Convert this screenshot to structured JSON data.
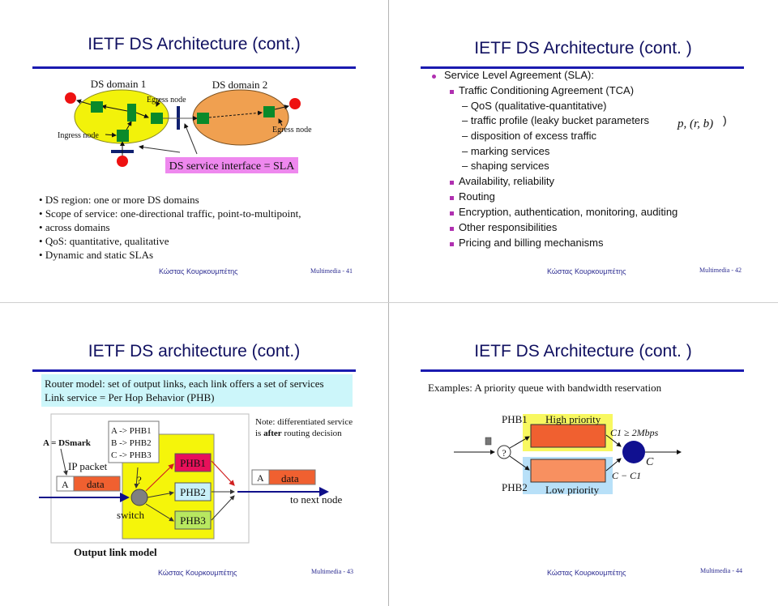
{
  "slides": [
    {
      "title": "IETF DS Architecture (cont.)",
      "diagram": {
        "domain1_label": "DS domain 1",
        "domain2_label": "DS domain 2",
        "egress1_label": "Egress node",
        "egress2_label": "Egress node",
        "ingress_label": "Ingress node",
        "sla_label": "DS service interface = SLA",
        "colors": {
          "domain1": "#f2f20a",
          "domain2": "#f0a050",
          "node": "#0a8a2a",
          "endpoint": "#ee1111",
          "interface": "#102070",
          "sla_box": "#ee88ee"
        }
      },
      "bullets": [
        "DS region: one or more DS domains",
        "Scope of service: one-directional traffic, point-to-multipoint,",
        "across domains",
        "QoS: quantitative, qualitative",
        "Dynamic and static SLAs"
      ],
      "footer": {
        "author": "Κώστας Κουρκουμπέτης",
        "page": "Multimedia  - 41"
      }
    },
    {
      "title": "IETF DS Architecture (cont. )",
      "items": [
        {
          "level": 1,
          "text": "Service Level Agreement (SLA):"
        },
        {
          "level": 2,
          "text": "Traffic Conditioning Agreement (TCA)"
        },
        {
          "level": 3,
          "text": "QoS (qualitative-quantitative)"
        },
        {
          "level": 3,
          "text": "traffic profile (leaky bucket parameters"
        },
        {
          "level": 3,
          "text": "disposition of  excess traffic"
        },
        {
          "level": 3,
          "text": "marking services"
        },
        {
          "level": 3,
          "text": "shaping services"
        },
        {
          "level": 2,
          "text": "Availability, reliability"
        },
        {
          "level": 2,
          "text": "Routing"
        },
        {
          "level": 2,
          "text": "Encryption, authentication, monitoring, auditing"
        },
        {
          "level": 2,
          "text": "Other responsibilities"
        },
        {
          "level": 2,
          "text": "Pricing and billing mechanisms"
        }
      ],
      "formula": "p, (r, b)",
      "formula_close": ")",
      "dash": "–",
      "footer": {
        "author": "Κώστας Κουρκουμπέτης",
        "page": "Multimedia  - 42"
      }
    },
    {
      "title": "IETF DS architecture (cont.)",
      "intro_lines": [
        "Router model: set of output links, each link offers a set of services",
        "Link service = Per Hop Behavior (PHB)"
      ],
      "diagram": {
        "dsmark_label": "A = DSmark",
        "mapping": [
          "A -> PHB1",
          "B -> PHB2",
          "C -> PHB3"
        ],
        "ip_packet_label": "IP packet",
        "header_label": "A",
        "data_label": "data",
        "question_mark": "?",
        "switch_label": "switch",
        "phb": [
          "PHB1",
          "PHB2",
          "PHB3"
        ],
        "note_line1": "Note: differentiated service",
        "note_line2_pre": "is ",
        "note_line2_bold": "after",
        "note_line2_post": " routing decision",
        "out_header": "A",
        "out_data": "data",
        "next_node_label": "to next node",
        "caption": "Output link model",
        "colors": {
          "intro_bg": "#ccf6fa",
          "switch_area": "#f5f50a",
          "phb1": "#e8105a",
          "phb2": "#c8f0f8",
          "phb3": "#b8e860",
          "data": "#f06030",
          "arrow": "#10108a"
        }
      },
      "footer": {
        "author": "Κώστας Κουρκουμπέτης",
        "page": "Multimedia  - 43"
      }
    },
    {
      "title": "IETF DS Architecture (cont. )",
      "intro": "Examples: A priority queue with bandwidth reservation",
      "diagram": {
        "phb1_label": "PHB1",
        "phb2_label": "PHB2",
        "high_label": "High priority",
        "low_label": "Low priority",
        "question_mark": "?",
        "c1_label": "C1 ≥ 2Mbps",
        "c_label": "C",
        "c_minus_label": "C − C1",
        "colors": {
          "high_bg": "#f8f860",
          "low_bg": "#b8e0f8",
          "high_queue": "#f06030",
          "low_queue": "#f89060",
          "server": "#101090"
        }
      },
      "footer": {
        "author": "Κώστας Κουρκουμπέτης",
        "page": "Multimedia  - 44"
      }
    }
  ]
}
